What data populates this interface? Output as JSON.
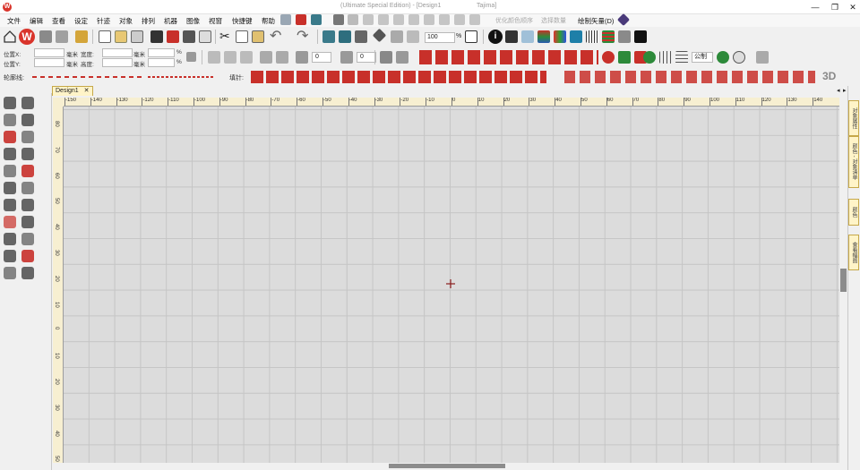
{
  "titlebar": {
    "title": "(Ultimate Special Edition) - [Design1",
    "machine": "Tajima]"
  },
  "window_controls": {
    "minimize": "—",
    "maximize": "❐",
    "close": "✕"
  },
  "menu": {
    "items": [
      "文件",
      "编辑",
      "查看",
      "设定",
      "针迹",
      "对象",
      "排列",
      "机器",
      "图像",
      "视窗",
      "快捷键",
      "帮助"
    ],
    "dimmed": [
      "优化颜色顺序",
      "选择数量"
    ],
    "draw_vector": "绘制矢量(D)"
  },
  "toolbar1": {
    "zoom_value": "100",
    "zoom_unit": "%"
  },
  "props": {
    "pos_x_label": "位置X:",
    "pos_y_label": "位置Y:",
    "width_label": "宽度:",
    "height_label": "高度:",
    "unit": "毫米",
    "percent": "%",
    "rotate_value": "0",
    "slant_value": "0",
    "unit_select": "公制"
  },
  "outline": {
    "label": "轮廓线:"
  },
  "fill": {
    "label": "填针:",
    "threeD": "3D"
  },
  "tab": {
    "name": "Design1"
  },
  "ruler": {
    "h_ticks": [
      "-150",
      "-140",
      "-130",
      "-120",
      "-110",
      "-100",
      "-90",
      "-80",
      "-70",
      "-60",
      "-50",
      "-40",
      "-30",
      "-20",
      "-10",
      "0",
      "10",
      "20",
      "30",
      "40",
      "50",
      "60",
      "70",
      "80",
      "90",
      "100",
      "110",
      "120",
      "130",
      "140"
    ],
    "v_ticks": [
      "80",
      "70",
      "60",
      "50",
      "40",
      "30",
      "20",
      "10",
      "0",
      "10",
      "20",
      "30",
      "40",
      "50"
    ]
  },
  "right_tabs": [
    "对象属性",
    "颜色 - 对象清单",
    "颜色",
    "查看幅图"
  ],
  "colors": {
    "accent_red": "#c8302a",
    "ruler_bg": "#f7efd1",
    "grid": "#c5c5c5"
  }
}
